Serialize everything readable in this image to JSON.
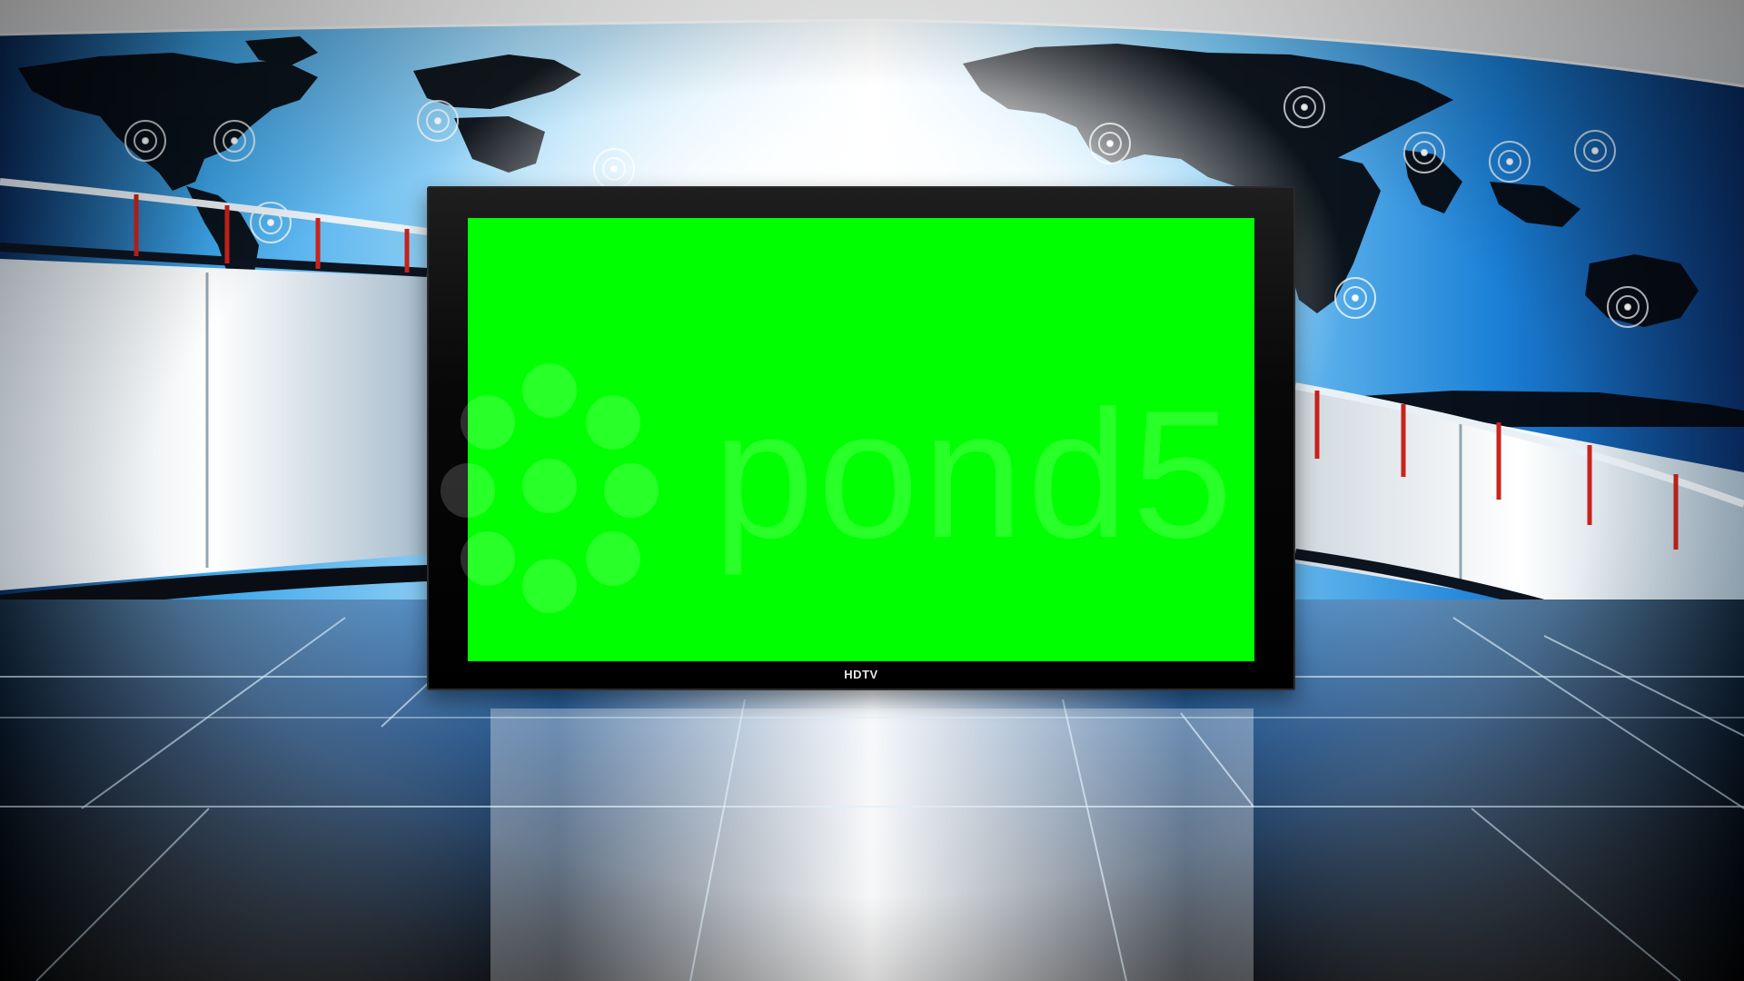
{
  "scene": {
    "type": "virtual news studio set",
    "colors": {
      "accent_blue": "#1a8fe0",
      "deep_blue": "#0b2f6a",
      "light_glow": "#ffffff",
      "railing_red": "#c8231c",
      "floor_dark": "#05070c"
    }
  },
  "monitor": {
    "brand_label": "HDTV",
    "screen_color": "#00ff00",
    "bezel_color": "#000000"
  },
  "watermark": {
    "text": "pond5"
  },
  "icons": {
    "map": "world-map-icon",
    "location_marker": "location-target-icon"
  }
}
